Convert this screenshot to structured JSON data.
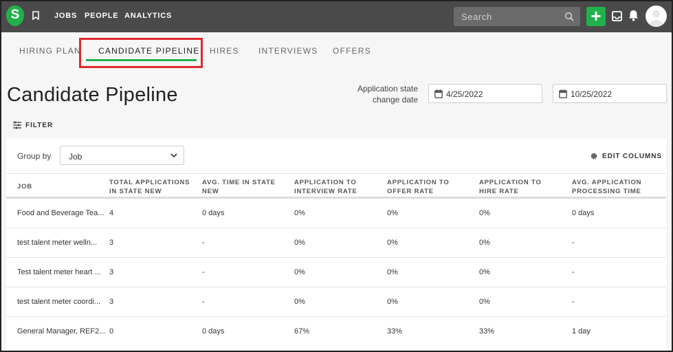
{
  "header": {
    "logo_letter": "S",
    "nav": [
      "JOBS",
      "PEOPLE",
      "ANALYTICS"
    ],
    "search_placeholder": "Search",
    "add_label": "+"
  },
  "tabs": [
    "HIRING PLAN",
    "CANDIDATE PIPELINE",
    "HIRES",
    "INTERVIEWS",
    "OFFERS"
  ],
  "active_tab": "CANDIDATE PIPELINE",
  "page_title": "Candidate Pipeline",
  "date_filter": {
    "label": "Application state change date",
    "start": "4/25/2022",
    "end": "10/25/2022"
  },
  "filter_label": "FILTER",
  "group_by": {
    "label": "Group by",
    "value": "Job"
  },
  "edit_columns_label": "EDIT COLUMNS",
  "columns": [
    "JOB",
    "TOTAL APPLICATIONS IN STATE NEW",
    "AVG. TIME IN STATE NEW",
    "APPLICATION TO INTERVIEW RATE",
    "APPLICATION TO OFFER RATE",
    "APPLICATION TO HIRE RATE",
    "AVG. APPLICATION PROCESSING TIME"
  ],
  "rows": [
    [
      "Food and Beverage Tea...",
      "4",
      "0 days",
      "0%",
      "0%",
      "0%",
      "0 days"
    ],
    [
      "test talent meter welln...",
      "3",
      "-",
      "0%",
      "0%",
      "0%",
      "-"
    ],
    [
      "Test talent meter heart ...",
      "3",
      "-",
      "0%",
      "0%",
      "0%",
      "-"
    ],
    [
      "test talent meter coordi...",
      "3",
      "-",
      "0%",
      "0%",
      "0%",
      "-"
    ],
    [
      "General Manager, REF2...",
      "0",
      "0 days",
      "67%",
      "33%",
      "33%",
      "1 day"
    ]
  ],
  "colors": {
    "accent": "#21b14b",
    "topbar": "#4a4a4a",
    "highlight": "#e0282e"
  }
}
